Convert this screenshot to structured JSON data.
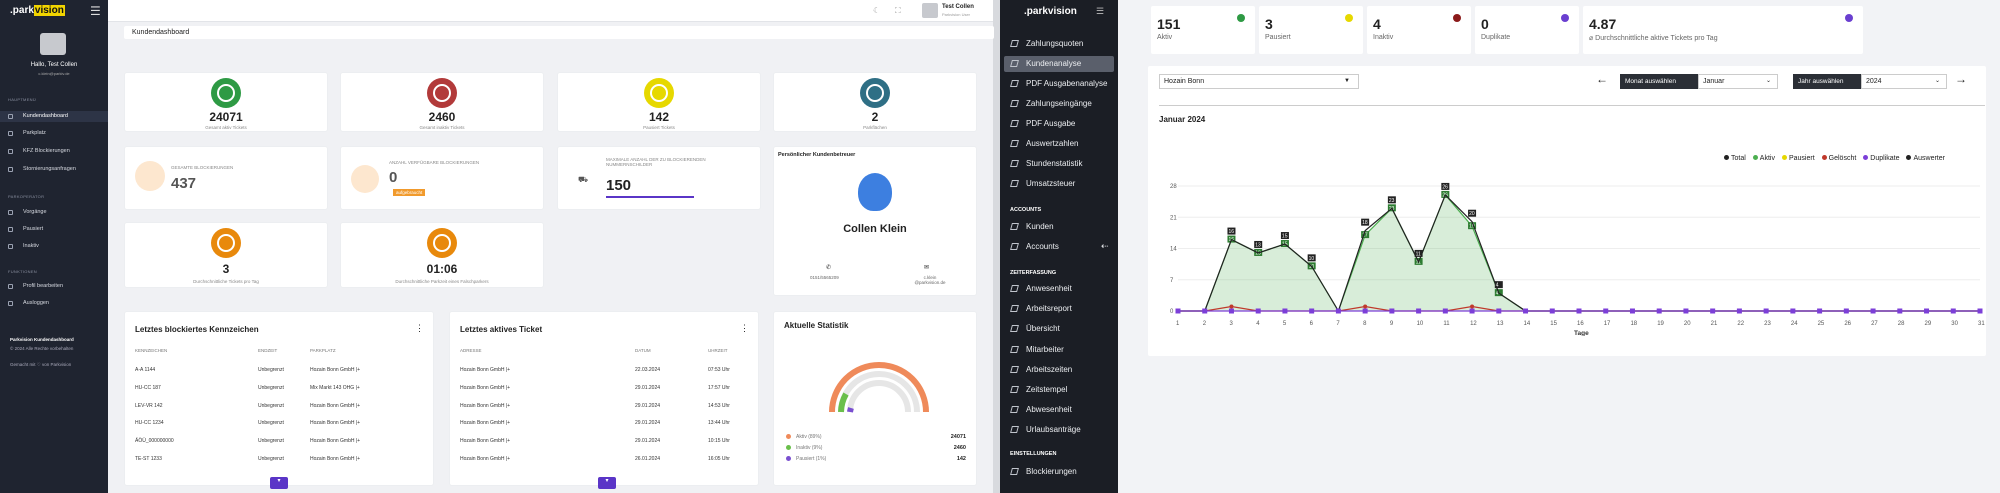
{
  "left": {
    "logo_prefix": ".park",
    "logo_brand": "vision",
    "hello": "Hallo, Test Collen",
    "email": "c.klein@parkiv.de",
    "sections": [
      "HAUPTMENÜ",
      "PARKOPERATOR",
      "FUNKTIONEN"
    ],
    "nav": [
      "Kundendashboard",
      "Parkplatz",
      "KFZ Blockierungen",
      "Stornierungsanfragen",
      "Vorgänge",
      "Pausiert",
      "Inaktiv",
      "Profil bearbeiten",
      "Ausloggen"
    ],
    "footer1": "Parkvision Kundendashboard",
    "footer2": "© 2024 Alle Rechte vorbehalten",
    "footer3": "Gemacht mit ♡ von Parkvision",
    "user_name": "Test Collen",
    "user_role": "Parkvision User",
    "page_title": "Kundendashboard",
    "stats": [
      {
        "value": "24071",
        "label": "Gesamt aktiv Tickets",
        "color": "#2e9a44"
      },
      {
        "value": "2460",
        "label": "Gesamt inaktiv Tickets",
        "color": "#b23a3a"
      },
      {
        "value": "142",
        "label": "Pausiert Tickets",
        "color": "#e6d800"
      },
      {
        "value": "2",
        "label": "Parkflächen",
        "color": "#2f6f85"
      }
    ],
    "blk_label": "GESAMTE BLOCKIERUNGEN",
    "blk_value": "437",
    "avail_label": "ANZAHL VERFÜGBARE BLOCKIERUNGEN",
    "avail_value": "0",
    "avail_badge": "aufgebraucht",
    "max_label": "MAXIMALE ANZAHL DER ZU BLOCKIERENDEN NUMMERNSCHILDER",
    "max_value": "150",
    "advisor_title": "Persönlicher Kundenbetreuer",
    "advisor_name": "Collen Klein",
    "advisor_phone": "0151/5565209",
    "advisor_mail": "c.klein @parkvision.de",
    "avg_tickets_value": "3",
    "avg_tickets_label": "Durchschnittliche Tickets pro Tag",
    "avg_time_value": "01:06",
    "avg_time_label": "Durchschnittliche Parkzeit eines Falschparkers",
    "blocked_title": "Letztes blockiertes Kennzeichen",
    "blocked_headers": [
      "KENNZEICHEN",
      "ENDZEIT",
      "PARKPLATZ"
    ],
    "blocked_rows": [
      [
        "A-A 1144",
        "Unbegrenzt",
        "Hozain Bonn GmbH |+"
      ],
      [
        "HU-CC 187",
        "Unbegrenzt",
        "Mix Markt 143 OHG |+"
      ],
      [
        "LEV-VR 142",
        "Unbegrenzt",
        "Hozain Bonn GmbH |+"
      ],
      [
        "HU-CC 1234",
        "Unbegrenzt",
        "Hozain Bonn GmbH |+"
      ],
      [
        "ÄÖÜ_000000000",
        "Unbegrenzt",
        "Hozain Bonn GmbH |+"
      ],
      [
        "TE-ST 1233",
        "Unbegrenzt",
        "Hozain Bonn GmbH |+"
      ]
    ],
    "active_title": "Letztes aktives Ticket",
    "active_headers": [
      "ADRESSE",
      "DATUM",
      "UHRZEIT"
    ],
    "active_rows": [
      [
        "Hozain Bonn GmbH |+",
        "22.03.2024",
        "07:53 Uhr"
      ],
      [
        "Hozain Bonn GmbH |+",
        "29.01.2024",
        "17:57 Uhr"
      ],
      [
        "Hozain Bonn GmbH |+",
        "29.01.2024",
        "14:53 Uhr"
      ],
      [
        "Hozain Bonn GmbH |+",
        "29.01.2024",
        "13:44 Uhr"
      ],
      [
        "Hozain Bonn GmbH |+",
        "29.01.2024",
        "10:15 Uhr"
      ],
      [
        "Hozain Bonn GmbH |+",
        "26.01.2024",
        "16:05 Uhr"
      ]
    ],
    "stat_title": "Aktuelle Statistik",
    "legend": [
      {
        "label": "Aktiv (89%)",
        "value": "24071",
        "color": "#ef8a5a"
      },
      {
        "label": "Inaktiv (9%)",
        "value": "2460",
        "color": "#6abf4b"
      },
      {
        "label": "Pausiert (1%)",
        "value": "142",
        "color": "#7a4fd0"
      }
    ]
  },
  "right": {
    "logo_prefix": ".park",
    "logo_brand": "vision",
    "nav_top": [
      "Zahlungsquoten",
      "Kundenanalyse",
      "PDF Ausgabenanalyse",
      "Zahlungseingänge",
      "PDF Ausgabe",
      "Auswertzahlen",
      "Stundenstatistik",
      "Umsatzsteuer"
    ],
    "sec_accounts": "ACCOUNTS",
    "nav_accounts": [
      "Kunden",
      "Accounts"
    ],
    "sec_time": "ZEITERFASSUNG",
    "nav_time": [
      "Anwesenheit",
      "Arbeitsreport",
      "Übersicht",
      "Mitarbeiter",
      "Arbeitszeiten",
      "Zeitstempel",
      "Abwesenheit",
      "Urlaubsanträge"
    ],
    "sec_settings": "EINSTELLUNGEN",
    "nav_settings": [
      "Blockierungen"
    ],
    "kpis": [
      {
        "value": "151",
        "label": "Aktiv",
        "color": "#2e9a44"
      },
      {
        "value": "3",
        "label": "Pausiert",
        "color": "#e6d800"
      },
      {
        "value": "4",
        "label": "Inaktiv",
        "color": "#8b1a1a"
      },
      {
        "value": "0",
        "label": "Duplikate",
        "color": "#6a3fd0"
      },
      {
        "value": "4.87",
        "label": "⌀ Durchschnittliche aktive Tickets pro Tag",
        "color": "#6a3fd0"
      }
    ],
    "location": "Hozain Bonn",
    "month_btn": "Monat auswählen",
    "month": "Januar",
    "year_btn": "Jahr auswählen",
    "year": "2024",
    "chart_title": "Januar 2024"
  },
  "chart_data": {
    "type": "area",
    "title": "Januar 2024",
    "xlabel": "Tage",
    "ylabel": "",
    "x": [
      1,
      2,
      3,
      4,
      5,
      6,
      7,
      8,
      9,
      10,
      11,
      12,
      13,
      14,
      15,
      16,
      17,
      18,
      19,
      20,
      21,
      22,
      23,
      24,
      25,
      26,
      27,
      28,
      29,
      30,
      31
    ],
    "ylim": [
      0,
      28
    ],
    "yticks": [
      0,
      7,
      14,
      21,
      28
    ],
    "legend": [
      "Total",
      "Aktiv",
      "Pausiert",
      "Gelöscht",
      "Duplikate",
      "Auswerter"
    ],
    "series": [
      {
        "name": "Aktiv",
        "color": "#4caf50",
        "values": [
          0,
          0,
          16,
          13,
          15,
          10,
          0,
          17,
          23,
          11,
          26,
          19,
          4,
          0,
          0,
          0,
          0,
          0,
          0,
          0,
          0,
          0,
          0,
          0,
          0,
          0,
          0,
          0,
          0,
          0,
          0
        ]
      },
      {
        "name": "Total",
        "color": "#222222",
        "values": [
          0,
          0,
          16,
          13,
          15,
          10,
          0,
          18,
          23,
          11,
          26,
          20,
          4,
          0,
          0,
          0,
          0,
          0,
          0,
          0,
          0,
          0,
          0,
          0,
          0,
          0,
          0,
          0,
          0,
          0,
          0
        ]
      },
      {
        "name": "Gelöscht",
        "color": "#c0392b",
        "values": [
          0,
          0,
          1,
          0,
          0,
          0,
          0,
          1,
          0,
          0,
          0,
          1,
          0,
          0,
          0,
          0,
          0,
          0,
          0,
          0,
          0,
          0,
          0,
          0,
          0,
          0,
          0,
          0,
          0,
          0,
          0
        ]
      },
      {
        "name": "Duplikate",
        "color": "#7c3fd8",
        "values": [
          0,
          0,
          0,
          0,
          0,
          0,
          0,
          0,
          0,
          0,
          0,
          0,
          0,
          0,
          0,
          0,
          0,
          0,
          0,
          0,
          0,
          0,
          0,
          0,
          0,
          0,
          0,
          0,
          0,
          0,
          0
        ]
      }
    ]
  }
}
